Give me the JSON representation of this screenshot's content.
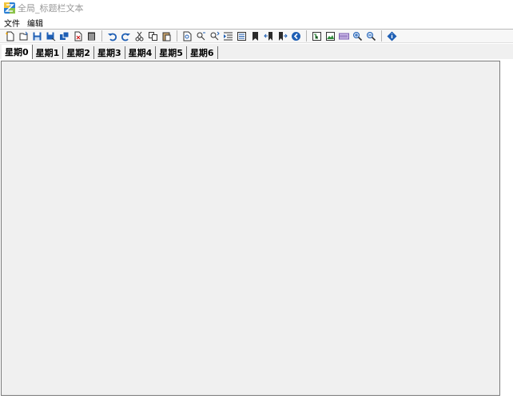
{
  "window": {
    "title": "全局_标题栏文本"
  },
  "menu": {
    "items": [
      "文件",
      "编辑"
    ]
  },
  "toolbar": {
    "groups": [
      [
        "new-icon",
        "open-icon",
        "save-icon",
        "save-as-icon",
        "save-all-icon",
        "close-icon",
        "print-icon"
      ],
      [
        "undo-icon",
        "redo-icon",
        "cut-icon",
        "copy-icon",
        "paste-icon"
      ],
      [
        "find-icon",
        "replace-icon",
        "find-next-icon",
        "indent-icon",
        "outdent-icon",
        "bookmark-icon",
        "prev-bookmark-icon",
        "next-bookmark-icon",
        "back-icon"
      ],
      [
        "tree-icon",
        "image-icon",
        "hex-icon",
        "zoom-in-icon",
        "zoom-out-icon"
      ],
      [
        "info-icon"
      ]
    ]
  },
  "tabs": {
    "items": [
      "星期0",
      "星期1",
      "星期2",
      "星期3",
      "星期4",
      "星期5",
      "星期6"
    ],
    "active": 0
  },
  "colors": {
    "title_text": "#999999",
    "client_bg": "#f0f0f0",
    "icon_blue": "#1f5fb4",
    "icon_dark": "#2b2b2b"
  }
}
